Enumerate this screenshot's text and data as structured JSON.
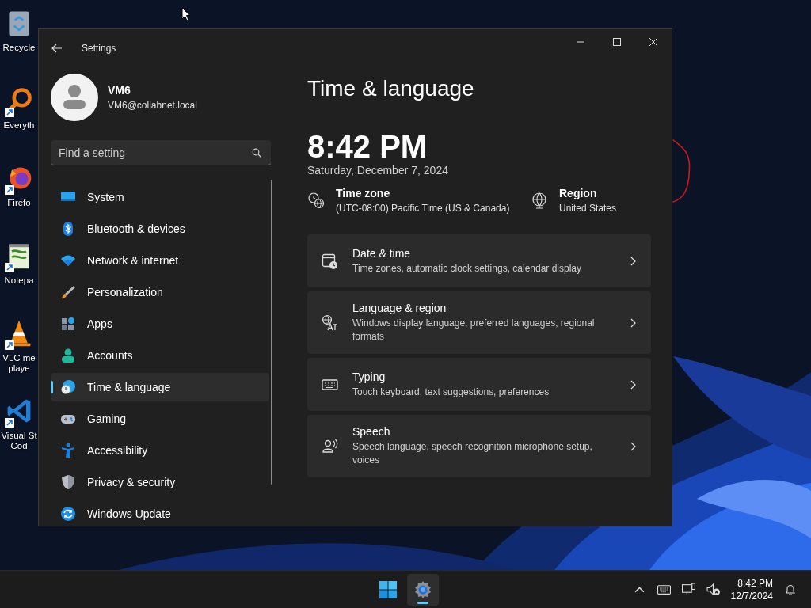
{
  "desktop": {
    "icons": [
      {
        "kind": "recycle",
        "lines": [
          "Recycle"
        ]
      },
      {
        "kind": "magnifier",
        "lines": [
          "Everyth"
        ]
      },
      {
        "kind": "fox",
        "lines": [
          "Firefo"
        ]
      },
      {
        "kind": "notepad",
        "lines": [
          "Notepa"
        ]
      },
      {
        "kind": "cone",
        "lines": [
          "VLC me",
          "playe"
        ]
      },
      {
        "kind": "code",
        "lines": [
          "Visual St",
          "Cod"
        ]
      }
    ]
  },
  "window": {
    "title": "Settings",
    "user": {
      "name": "VM6",
      "email": "VM6@collabnet.local"
    },
    "search": {
      "placeholder": "Find a setting"
    },
    "nav": [
      {
        "label": "System",
        "kind": "system",
        "selected": false
      },
      {
        "label": "Bluetooth & devices",
        "kind": "bluetooth",
        "selected": false
      },
      {
        "label": "Network & internet",
        "kind": "wifi",
        "selected": false
      },
      {
        "label": "Personalization",
        "kind": "brush",
        "selected": false
      },
      {
        "label": "Apps",
        "kind": "apps",
        "selected": false
      },
      {
        "label": "Accounts",
        "kind": "person",
        "selected": false
      },
      {
        "label": "Time & language",
        "kind": "clockglobe",
        "selected": true
      },
      {
        "label": "Gaming",
        "kind": "gamepad",
        "selected": false
      },
      {
        "label": "Accessibility",
        "kind": "accessibility",
        "selected": false
      },
      {
        "label": "Privacy & security",
        "kind": "shield",
        "selected": false
      },
      {
        "label": "Windows Update",
        "kind": "update",
        "selected": false
      }
    ],
    "page_title": "Time & language",
    "time": "8:42 PM",
    "date": "Saturday, December 7, 2024",
    "info": [
      {
        "kind": "timezone",
        "label": "Time zone",
        "value": "(UTC-08:00) Pacific Time (US & Canada)"
      },
      {
        "kind": "globe",
        "label": "Region",
        "value": "United States"
      }
    ],
    "cards": [
      {
        "kind": "calendar",
        "title": "Date & time",
        "description": "Time zones, automatic clock settings, calendar display"
      },
      {
        "kind": "language",
        "title": "Language & region",
        "description": "Windows display language, preferred languages, regional formats"
      },
      {
        "kind": "keyboard",
        "title": "Typing",
        "description": "Touch keyboard, text suggestions, preferences"
      },
      {
        "kind": "speech",
        "title": "Speech",
        "description": "Speech language, speech recognition microphone setup, voices"
      }
    ]
  },
  "taskbar": {
    "apps": [
      {
        "kind": "start",
        "active": false
      },
      {
        "kind": "settings",
        "active": true
      }
    ],
    "tray": [
      {
        "kind": "chevron"
      },
      {
        "kind": "keyboard"
      },
      {
        "kind": "network"
      },
      {
        "kind": "muted"
      }
    ],
    "clock": {
      "time": "8:42 PM",
      "date": "12/7/2024"
    }
  }
}
